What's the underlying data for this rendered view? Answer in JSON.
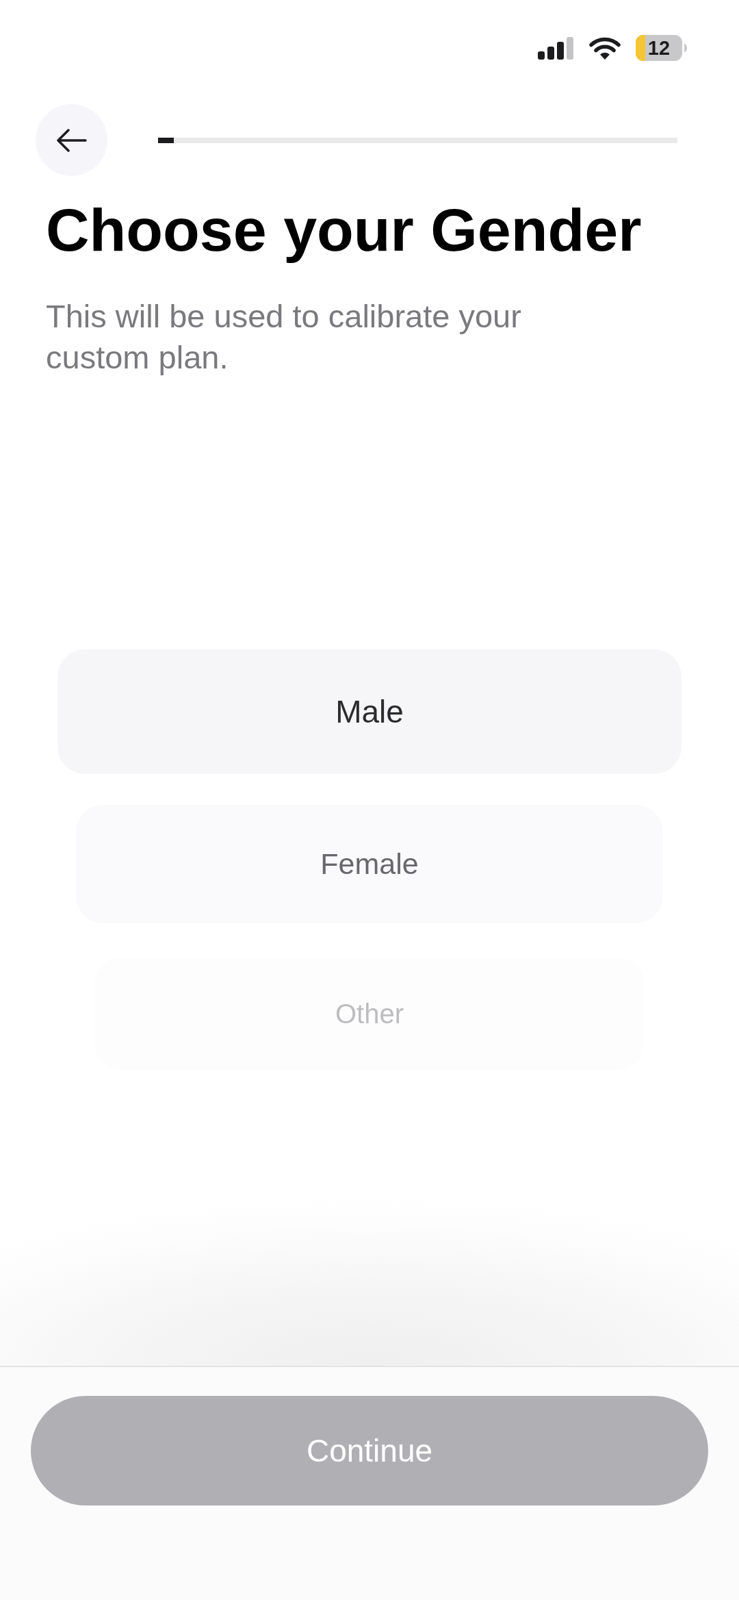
{
  "status_bar": {
    "battery": "12",
    "low_power_mode": true
  },
  "progress": {
    "level": 0.03
  },
  "title": "Choose your Gender",
  "subtitle": "This will be used to calibrate your custom plan.",
  "options": [
    {
      "label": "Male",
      "selected": true
    },
    {
      "label": "Female",
      "selected": false
    },
    {
      "label": "Other",
      "selected": false
    }
  ],
  "continue_button": {
    "label": "Continue",
    "disabled": true
  }
}
